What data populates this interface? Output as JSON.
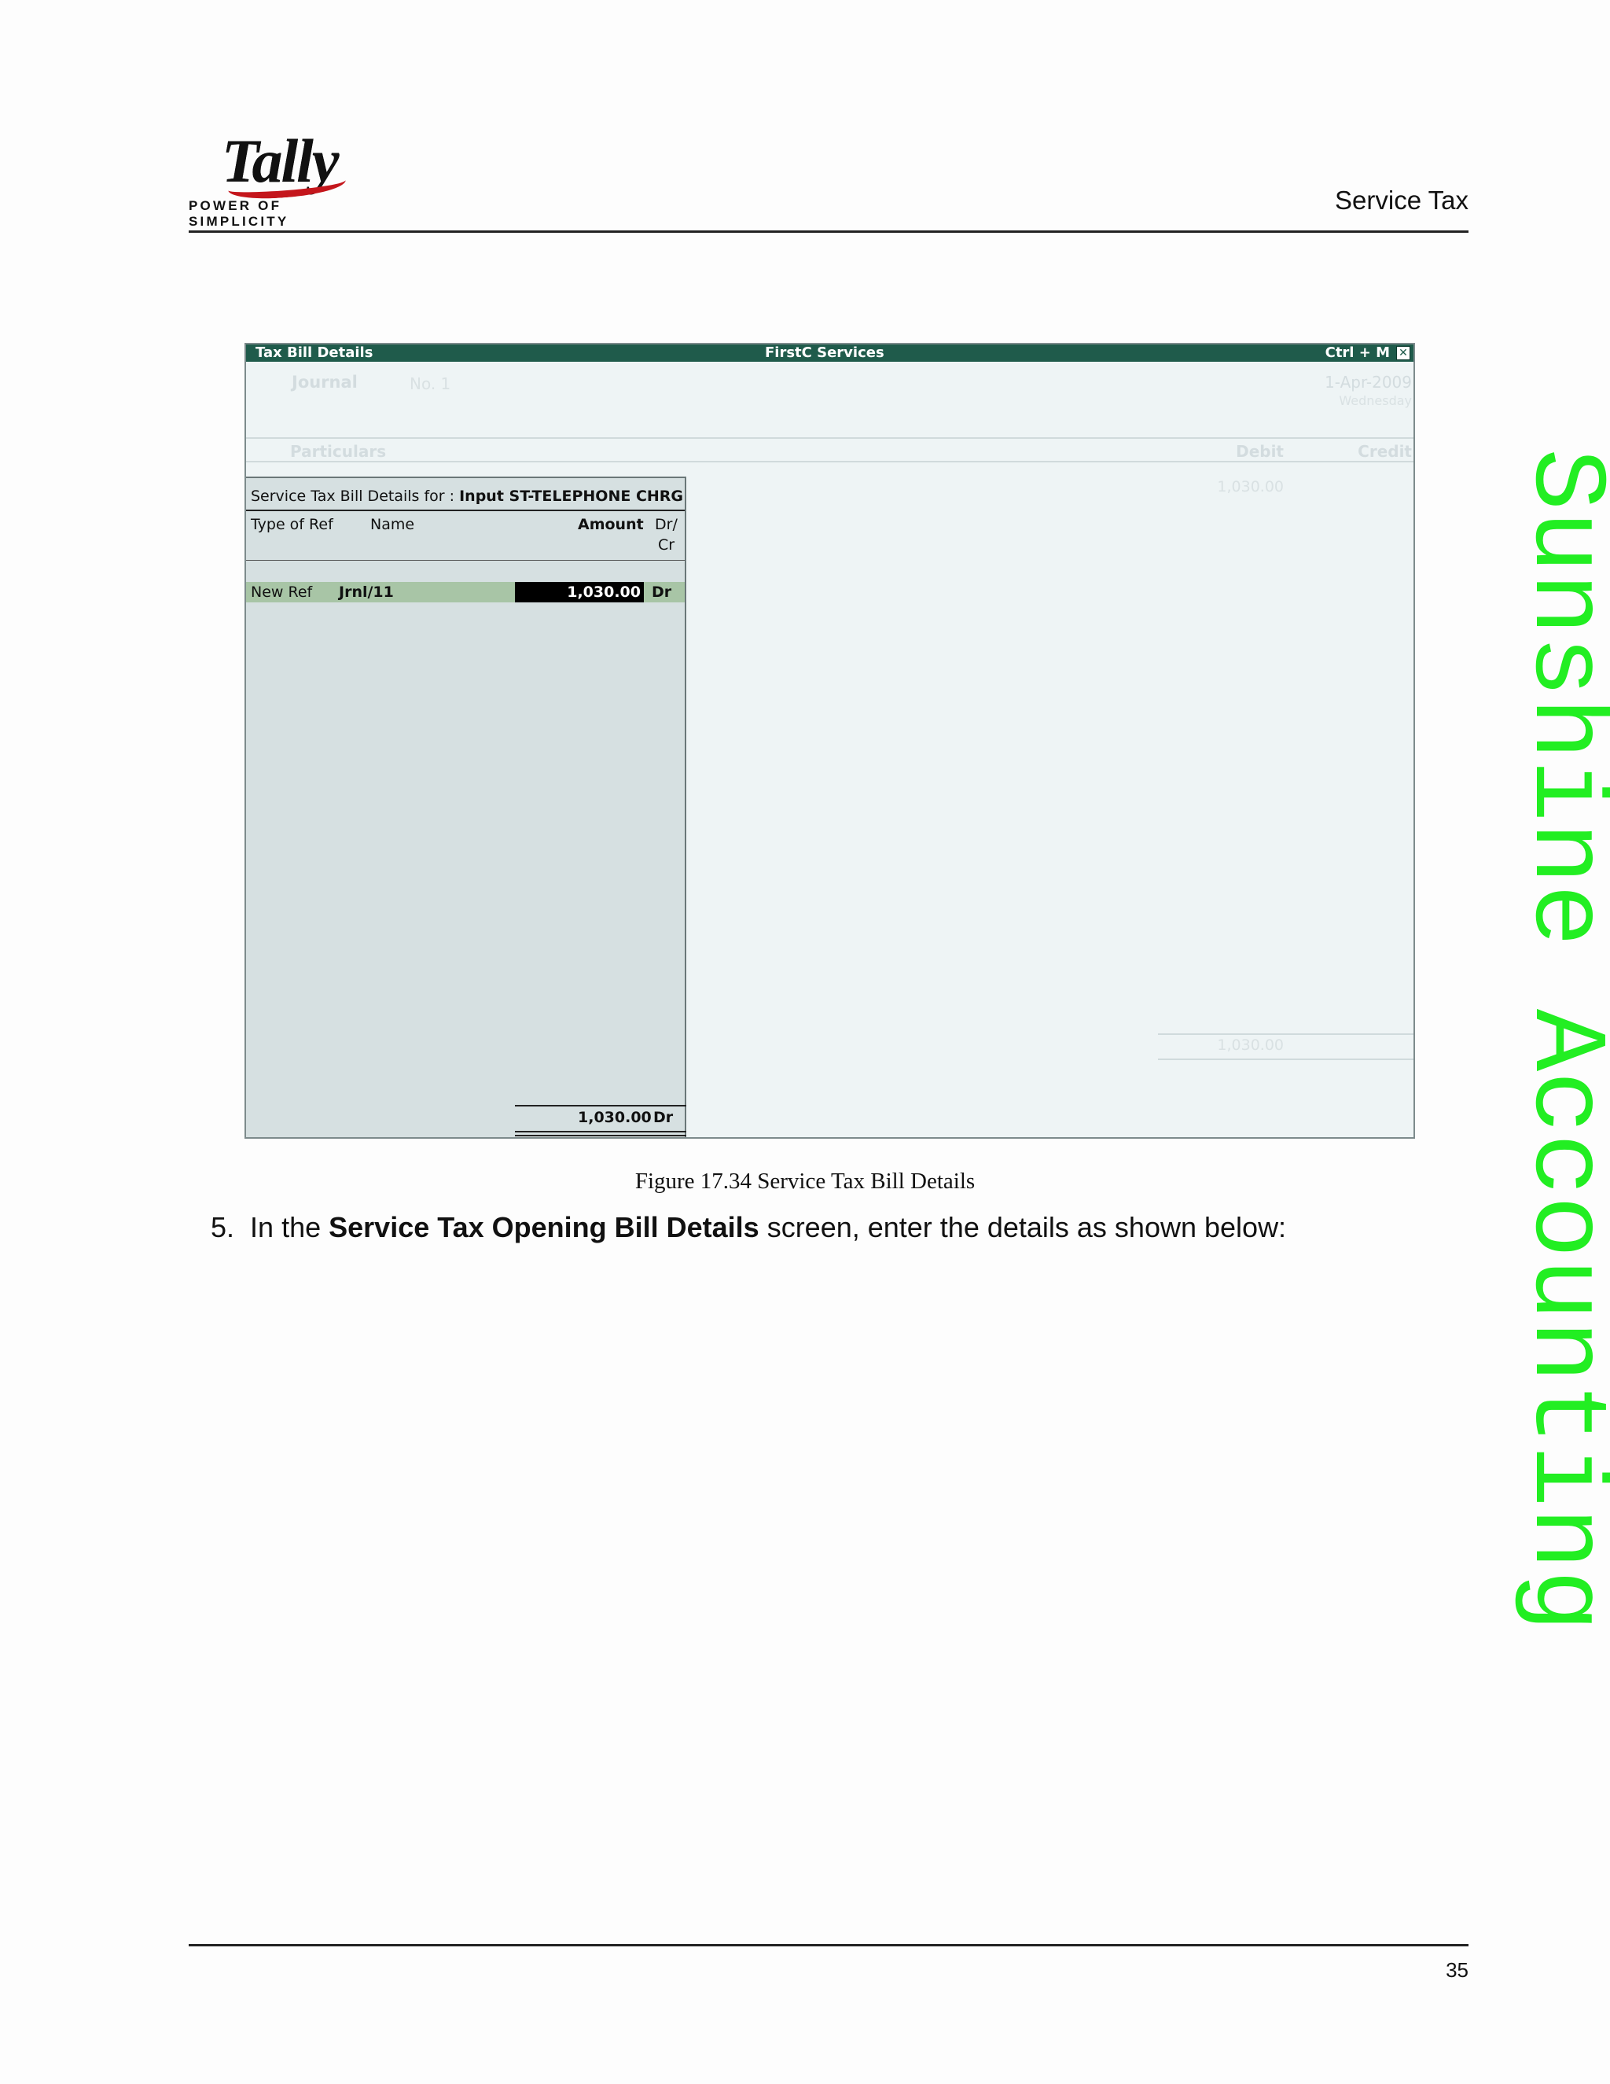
{
  "header": {
    "logo_word": "Tally",
    "logo_tagline": "POWER OF SIMPLICITY",
    "section_title": "Service Tax"
  },
  "screen": {
    "title_left": "Tax Bill Details",
    "title_center": "FirstC Services",
    "title_right": "Ctrl + M",
    "close_glyph": "✕",
    "voucher_type": "Journal",
    "voucher_no": "No. 1",
    "date": "1-Apr-2009",
    "day": "Wednesday",
    "col_particulars": "Particulars",
    "col_debit": "Debit",
    "col_credit": "Credit",
    "debit_value": "1,030.00",
    "debit_total": "1,030.00",
    "panel": {
      "title_prefix": "Service Tax Bill Details for :",
      "ledger": "Input ST-TELEPHONE CHRG",
      "col_type": "Type of Ref",
      "col_name": "Name",
      "col_amount": "Amount",
      "col_drcr_1": "Dr/",
      "col_drcr_2": "Cr",
      "row": {
        "type": "New Ref",
        "name": "Jrnl/11",
        "amount": "1,030.00",
        "drcr": "Dr"
      },
      "total_amount": "1,030.00",
      "total_drcr": "Dr"
    }
  },
  "caption": "Figure 17.34  Service Tax Bill Details",
  "step": {
    "number": "5.",
    "prefix": "In the",
    "bold": "Service Tax Opening Bill Details",
    "suffix": "screen, enter the details as shown below:"
  },
  "watermark": "Sunshine Accounting",
  "page_number": "35"
}
